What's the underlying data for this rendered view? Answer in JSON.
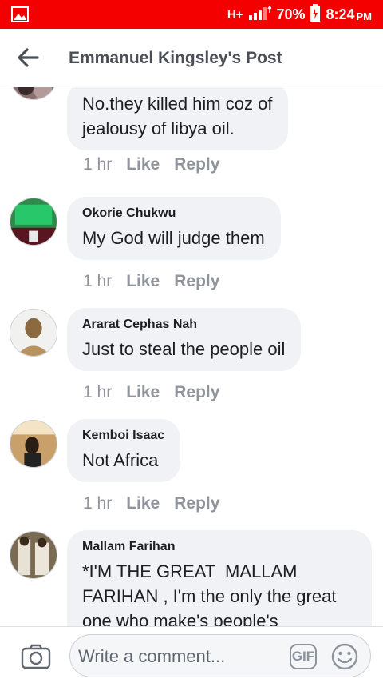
{
  "status_bar": {
    "network": "H+",
    "battery": "70%",
    "time": "8:24",
    "ampm": "PM",
    "icons": [
      "gallery-icon",
      "signal-icon",
      "battery-icon"
    ]
  },
  "header": {
    "title": "Emmanuel Kingsley's Post",
    "back_icon": "arrow-left-icon"
  },
  "comments": [
    {
      "author": "",
      "text": "No.they killed him coz of\njealousy of libya oil.",
      "time": "1 hr",
      "like": "Like",
      "reply": "Reply"
    },
    {
      "author": "Okorie Chukwu",
      "text": "My God will judge them",
      "time": "1 hr",
      "like": "Like",
      "reply": "Reply"
    },
    {
      "author": "Ararat Cephas Nah",
      "text": "Just to steal the people oil",
      "time": "1 hr",
      "like": "Like",
      "reply": "Reply"
    },
    {
      "author": "Kemboi Isaac",
      "text": "Not Africa",
      "time": "1 hr",
      "like": "Like",
      "reply": "Reply"
    },
    {
      "author": "Mallam Farihan",
      "text": "*I'M THE GREAT  MALLAM\nFARIHAN , I'm the only the great\none who make's people's",
      "time": "",
      "like": "",
      "reply": ""
    }
  ],
  "composer": {
    "placeholder": "Write a comment...",
    "gif_label": "GIF",
    "icons": [
      "camera-icon",
      "gif-icon",
      "emoji-icon"
    ]
  },
  "colors": {
    "status_bar": "#f50000",
    "bubble": "#f0f2f5",
    "meta_text": "#90949c",
    "header_text": "#4b4f56"
  }
}
